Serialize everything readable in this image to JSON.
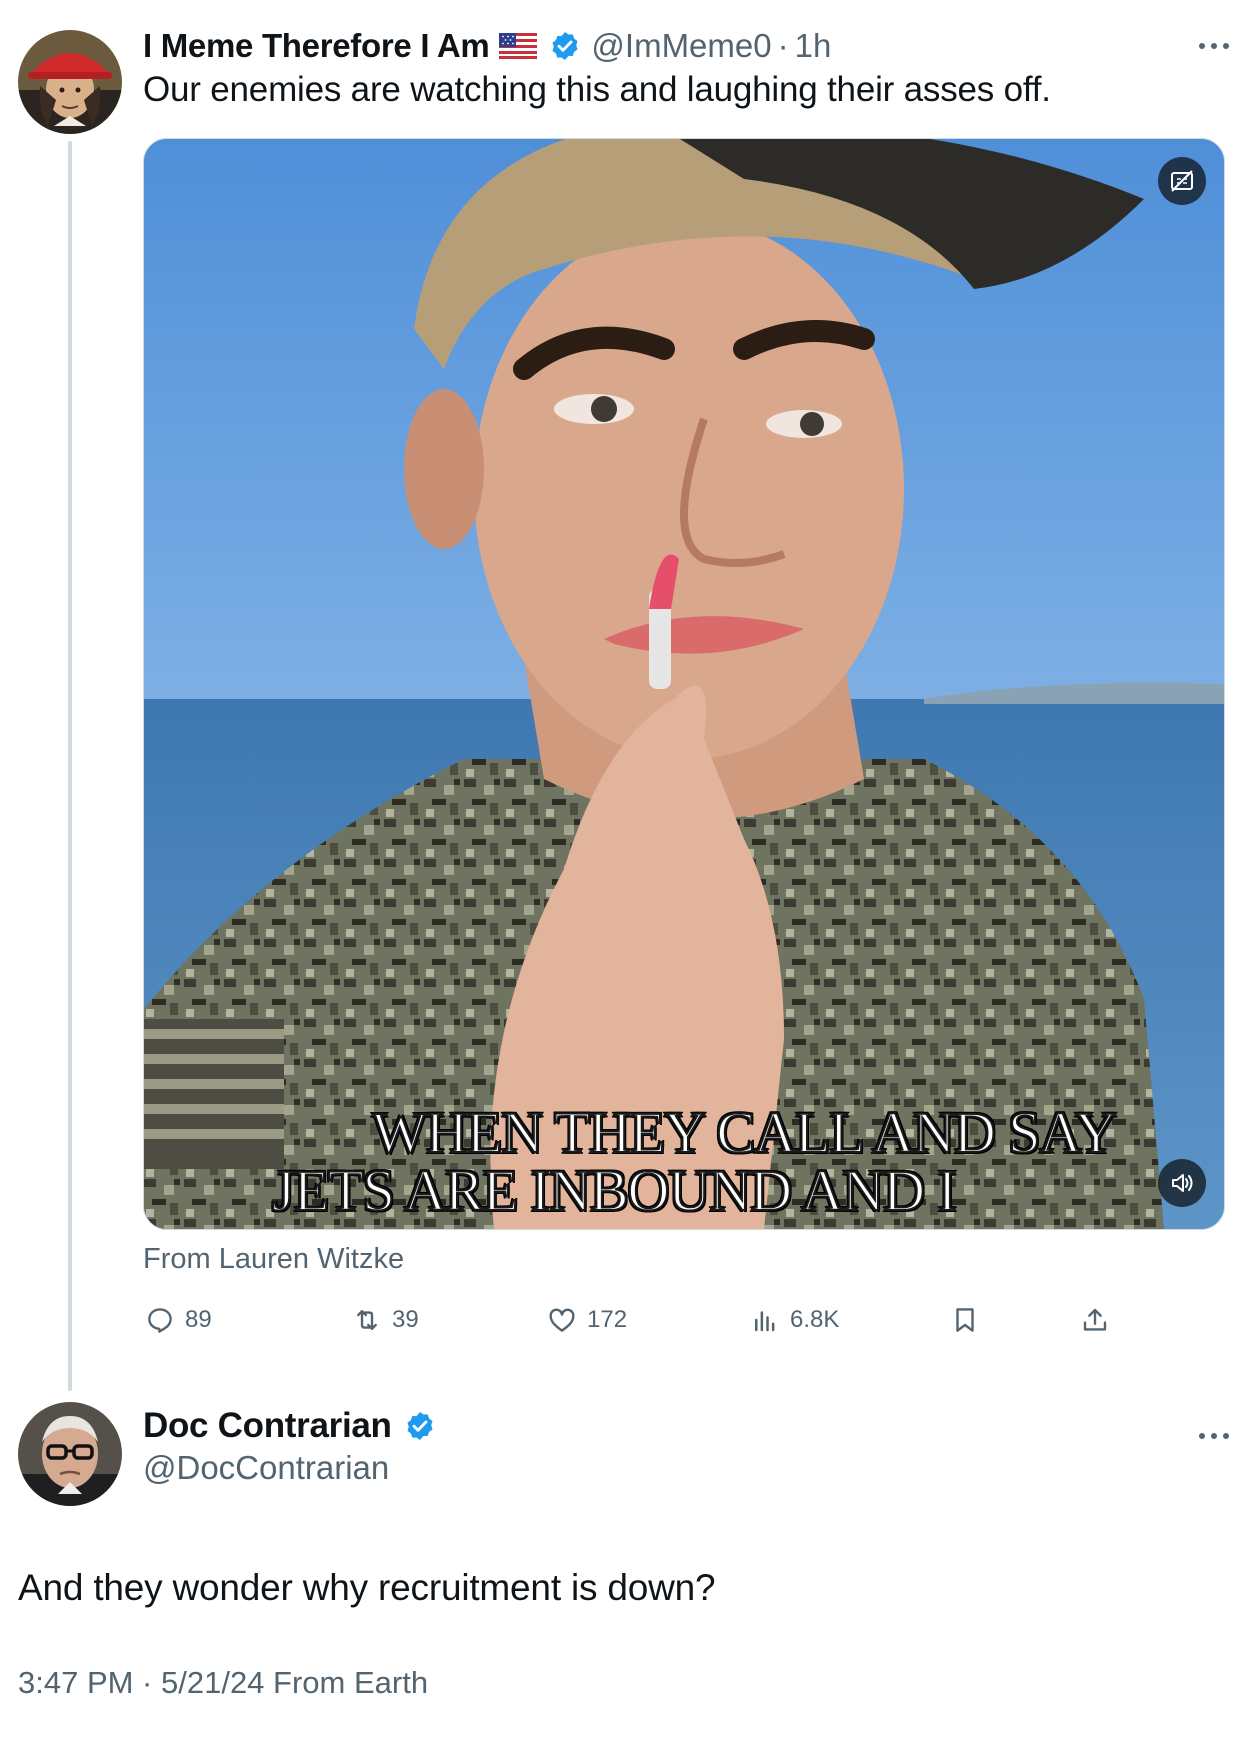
{
  "tweet": {
    "author_name": "I Meme Therefore I Am",
    "author_flag": "us-flag-icon",
    "handle": "@ImMeme0",
    "separator": "·",
    "time_ago": "1h",
    "text": "Our enemies are watching this and laughing their asses off.",
    "media": {
      "caption_line1": "WHEN THEY CALL AND SAY",
      "caption_line2": "JETS ARE INBOUND AND I",
      "source": "From Lauren Witzke"
    },
    "actions": {
      "replies": "89",
      "retweets": "39",
      "likes": "172",
      "views": "6.8K"
    }
  },
  "reply": {
    "author_name": "Doc Contrarian",
    "handle": "@DocContrarian",
    "text": "And they wonder why recruitment is down?",
    "timestamp": "3:47 PM · 5/21/24 From Earth"
  },
  "colors": {
    "verified": "#1d9bf0",
    "secondary_text": "#536471",
    "thread_line": "#cfd9de"
  }
}
